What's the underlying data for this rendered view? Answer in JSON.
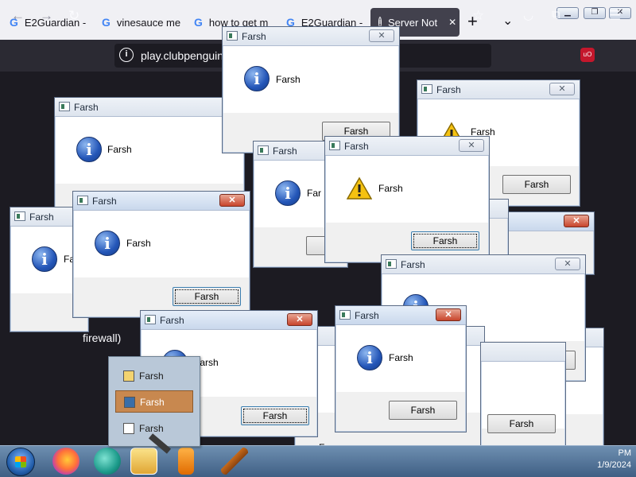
{
  "browser": {
    "tabs": [
      {
        "label": "E2Guardian -",
        "icon": "google-g-icon"
      },
      {
        "label": "vinesauce me",
        "icon": "google-g-icon"
      },
      {
        "label": "how to get m",
        "icon": "google-g-icon"
      },
      {
        "label": "E2Guardian -",
        "icon": "google-g-icon"
      },
      {
        "label": "Server Not",
        "icon": "info-icon"
      }
    ],
    "url_domain": "play.clubpenguin",
    "page_caption": "firewall)"
  },
  "dialog": {
    "title": "Farsh",
    "message": "Farsh",
    "button_label": "Farsh",
    "message_visible_1": "Fa",
    "message_visible_2": "Far"
  },
  "jumplist": {
    "items": [
      "Farsh",
      "Farsh",
      "Farsh"
    ],
    "selected_index": 1
  },
  "taskbar": {
    "clock_time": "PM",
    "clock_date": "1/9/2024"
  },
  "colors": {
    "accent_close": "#c8452c",
    "taskbar": "#4f6f93",
    "browser_dark": "#2b2a33"
  }
}
